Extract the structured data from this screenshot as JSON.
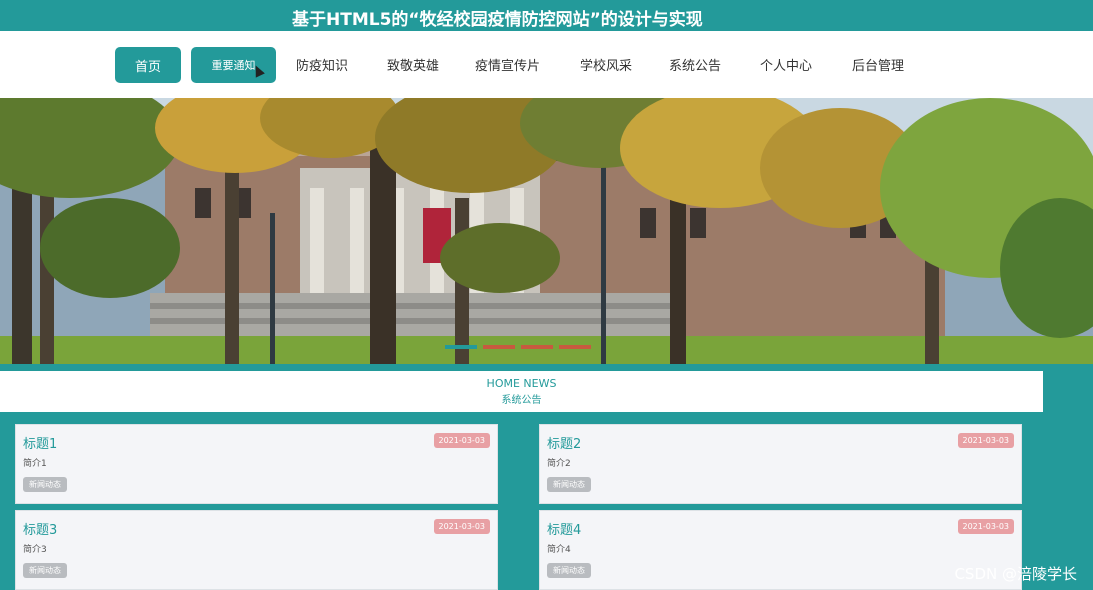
{
  "site_title": "基于HTML5的“牧经校园疫情防控网站”的设计与实现",
  "nav": {
    "home": "首页",
    "notice": "重要通知",
    "links": [
      "防疫知识",
      "致敬英雄",
      "疫情宣传片",
      "学校风采",
      "系统公告",
      "个人中心",
      "后台管理"
    ]
  },
  "banner": {
    "icon": "campus-photo"
  },
  "section": {
    "en": "HOME NEWS",
    "cn": "系统公告"
  },
  "news": [
    {
      "title": "标题1",
      "date": "2021-03-03",
      "desc": "简介1",
      "tag": "新闻动态"
    },
    {
      "title": "标题2",
      "date": "2021-03-03",
      "desc": "简介2",
      "tag": "新闻动态"
    },
    {
      "title": "标题3",
      "date": "2021-03-03",
      "desc": "简介3",
      "tag": "新闻动态"
    },
    {
      "title": "标题4",
      "date": "2021-03-03",
      "desc": "简介4",
      "tag": "新闻动态"
    }
  ],
  "watermark": "CSDN @涪陵学长",
  "colors": {
    "primary": "#239a9a",
    "date_badge": "#e8a0a4",
    "tag": "#b9bcc0"
  }
}
